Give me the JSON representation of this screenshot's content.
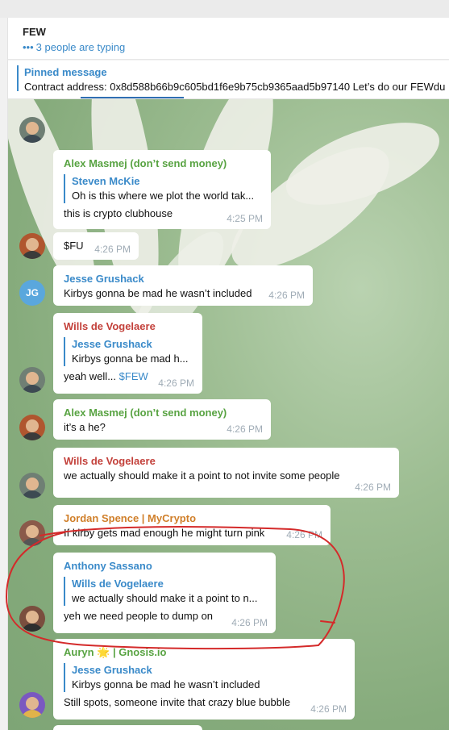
{
  "header": {
    "title": "FEW",
    "typing_dots": "•••",
    "typing_status": "3 people are typing"
  },
  "pinned": {
    "title": "Pinned message",
    "text": "Contract address: 0x8d588b66b9c605bd1f6e9b75cb9365aad5b97140  Let’s do our FEWdu"
  },
  "messages": [
    {
      "sender": "Alex Masmej (don’t send money)",
      "reply_name": "Steven McKie",
      "reply_text": "Oh is this where we plot the world tak...",
      "text": "this is crypto clubhouse",
      "time": "4:25 PM"
    },
    {
      "text": "$FU",
      "time": "4:26 PM"
    },
    {
      "sender": "Jesse Grushack",
      "avatar_initials": "JG",
      "text": "Kirbys gonna be mad he wasn’t included",
      "time": "4:26 PM"
    },
    {
      "sender": "Wills de Vogelaere",
      "reply_name": "Jesse Grushack",
      "reply_text": "Kirbys gonna be mad h...",
      "text": "yeah well...",
      "link": "$FEW",
      "time": "4:26 PM"
    },
    {
      "sender": "Alex Masmej (don’t send money)",
      "text": "it’s a he?",
      "time": "4:26 PM"
    },
    {
      "sender": "Wills de Vogelaere",
      "text": "we actually should make it a point to not invite some people",
      "time": "4:26 PM"
    },
    {
      "sender": "Jordan Spence | MyCrypto",
      "text": "If kirby gets mad enough he might turn pink",
      "time": "4:26 PM"
    },
    {
      "sender": "Anthony Sassano",
      "reply_name": "Wills de Vogelaere",
      "reply_text": "we actually should make it a point to n...",
      "text": "yeh we need people to dump on",
      "time": "4:26 PM"
    },
    {
      "sender_prefix": "Auryn",
      "sender_emoji": "🌟",
      "sender_suffix": "| Gnosis.io",
      "reply_name": "Jesse Grushack",
      "reply_text": "Kirbys gonna be mad he wasn’t included",
      "text": "Still spots, someone invite that crazy blue bubble",
      "time": "4:26 PM"
    }
  ],
  "colors": {
    "accent": "#3a8ac9",
    "sender_green": "#58a342",
    "sender_red": "#c3413b",
    "sender_orange": "#d07f2a",
    "annotation_red": "#d42a2a"
  }
}
